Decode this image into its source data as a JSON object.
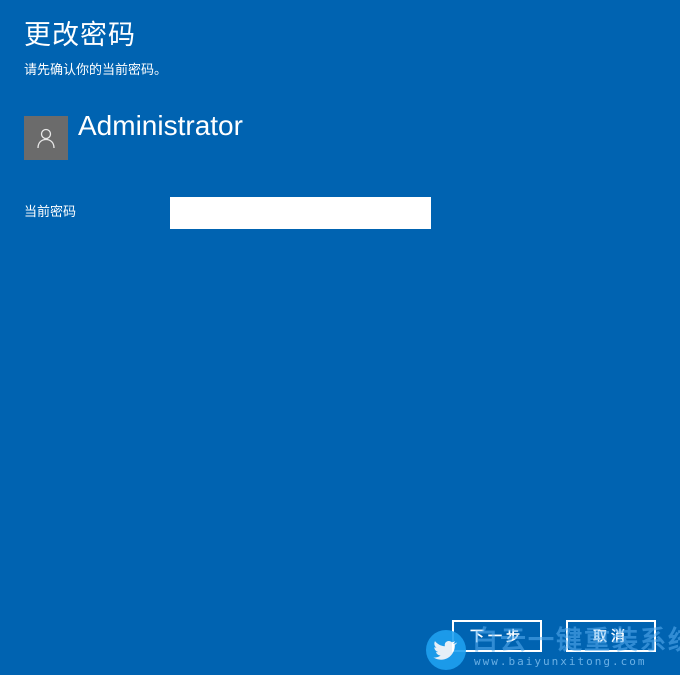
{
  "dialog": {
    "title": "更改密码",
    "subtitle": "请先确认你的当前密码。"
  },
  "account": {
    "username": "Administrator",
    "avatar_icon": "user-icon"
  },
  "form": {
    "current_password_label": "当前密码",
    "current_password_value": ""
  },
  "buttons": {
    "next_label": "下一步",
    "cancel_label": "取消"
  },
  "watermark": {
    "text": "白云一键重装系统",
    "url": "www.baiyunxitong.com"
  },
  "colors": {
    "background": "#0063b1",
    "avatar_bg": "#6b6b6b",
    "text": "#ffffff",
    "input_bg": "#ffffff"
  }
}
